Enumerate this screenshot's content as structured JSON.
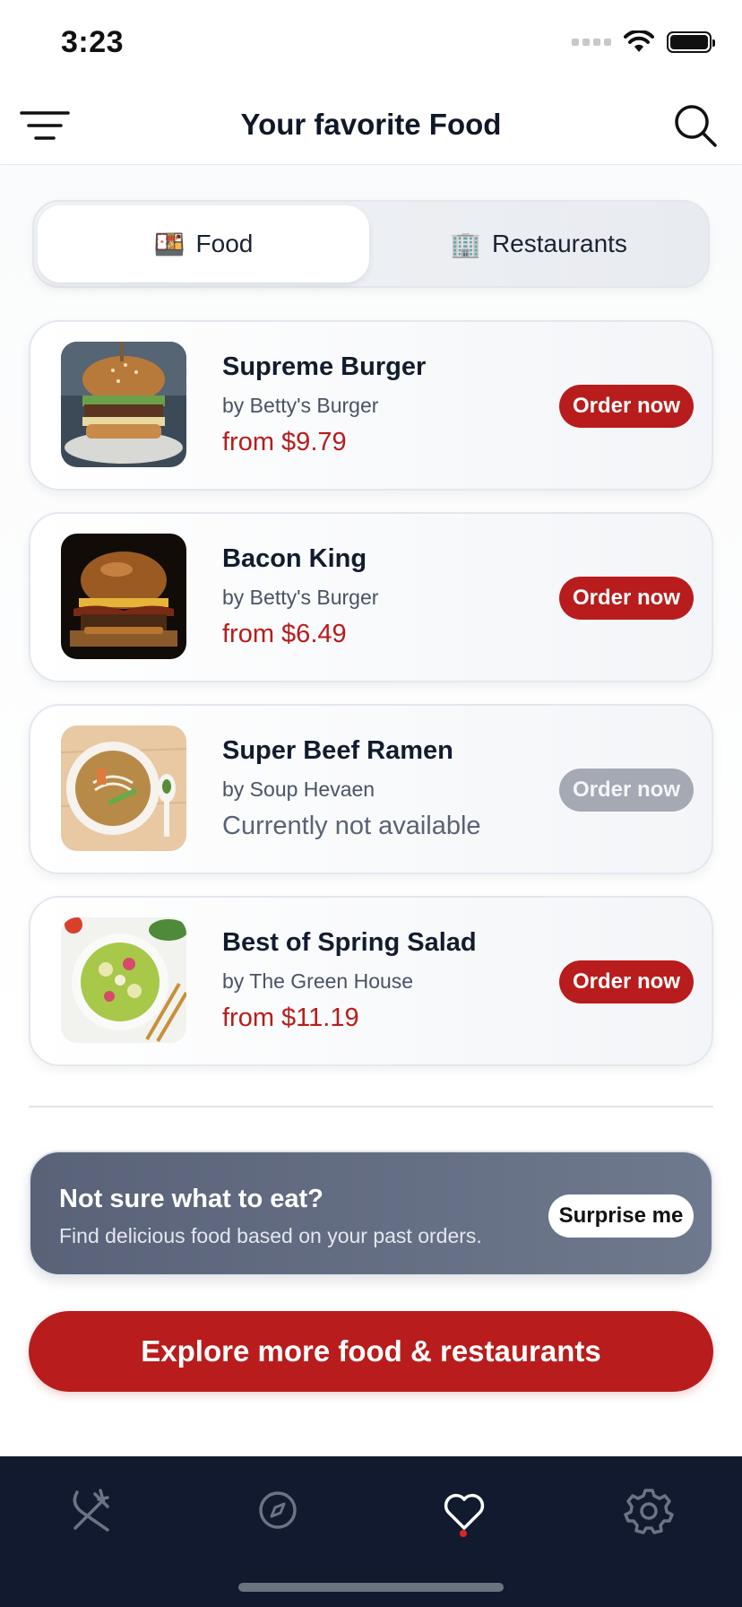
{
  "status_bar": {
    "time": "3:23"
  },
  "header": {
    "title": "Your favorite Food"
  },
  "segments": [
    {
      "emoji": "🍱",
      "label": "Food",
      "active": true
    },
    {
      "emoji": "🏢",
      "label": "Restaurants",
      "active": false
    }
  ],
  "items": [
    {
      "name": "Supreme Burger",
      "by": "by Betty's Burger",
      "price": "from $9.79",
      "button": "Order now",
      "available": true,
      "image": "burger-photo"
    },
    {
      "name": "Bacon King",
      "by": "by Betty's Burger",
      "price": "from $6.49",
      "button": "Order now",
      "available": true,
      "image": "burger-photo"
    },
    {
      "name": "Super Beef Ramen",
      "by": "by Soup Hevaen",
      "price": "Currently not available",
      "button": "Order now",
      "available": false,
      "image": "ramen-photo"
    },
    {
      "name": "Best of Spring Salad",
      "by": "by The Green House",
      "price": "from $11.19",
      "button": "Order now",
      "available": true,
      "image": "salad-photo"
    }
  ],
  "surprise": {
    "title": "Not sure what to eat?",
    "text": "Find delicious food based on your past orders.",
    "button": "Surprise me"
  },
  "explore_button": "Explore more food & restaurants",
  "tabbar": {
    "items": [
      {
        "icon": "fork-knife-icon",
        "active": false
      },
      {
        "icon": "compass-icon",
        "active": false
      },
      {
        "icon": "heart-icon",
        "active": true
      },
      {
        "icon": "gear-icon",
        "active": false
      }
    ]
  },
  "colors": {
    "accent": "#b91c1c",
    "tabbar_bg": "#111a2e",
    "card_dark": "#596278"
  }
}
